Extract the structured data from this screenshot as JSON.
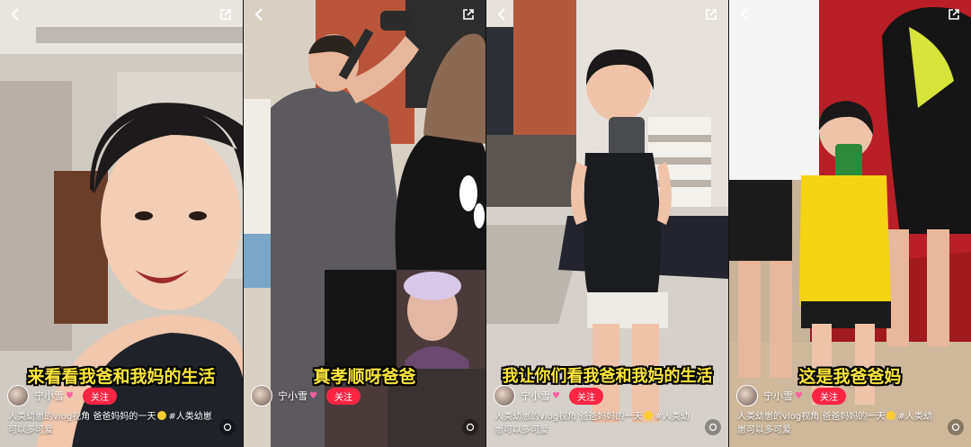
{
  "panels": [
    {
      "caption": "来看看我爸和我妈的生活",
      "author": "宁小雪",
      "follow": "关注",
      "desc": "人类幼崽的vlog视角 爸爸妈妈的一天",
      "desc_tail": "#人类幼崽可以多可爱"
    },
    {
      "caption": "真孝顺呀爸爸",
      "author": "宁小雪",
      "follow": "关注",
      "desc": "",
      "desc_tail": ""
    },
    {
      "caption": "我让你们看我爸和我妈的生活",
      "author": "宁小雪",
      "follow": "关注",
      "desc": "人类幼崽的vlog视角 爸爸妈妈的一天",
      "desc_tail": "#人类幼崽可以多可爱"
    },
    {
      "caption": "这是我爸爸妈",
      "author": "宁小雪",
      "follow": "关注",
      "desc": "人类幼崽的vlog视角 爸爸妈妈的一天",
      "desc_tail": "#人类幼崽可以多可爱"
    }
  ],
  "icons": {
    "back": "chevron-left-icon",
    "share": "share-icon",
    "avatar": "avatar",
    "heart": "heart-icon",
    "more": "more-icon"
  }
}
